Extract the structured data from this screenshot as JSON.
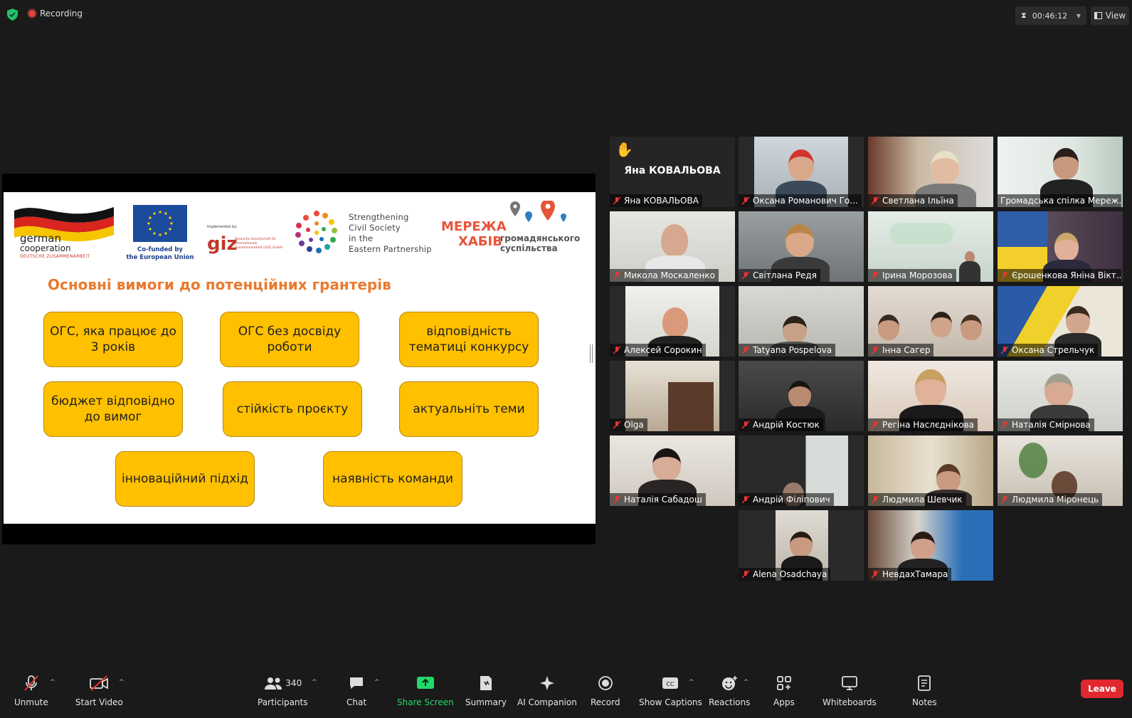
{
  "topbar": {
    "recording_label": "Recording",
    "timer": "00:46:12",
    "view_label": "View"
  },
  "slide": {
    "logos": {
      "german_line1": "german",
      "german_line2": "cooperation",
      "german_sub": "DEUTSCHE ZUSAMMENARBEIT",
      "eu_line1": "Co-funded by",
      "eu_line2": "the European Union",
      "giz_implemented": "Implemented by:",
      "giz": "giz",
      "giz_small": "Deutsche Gesellschaft für Internationale Zusammenarbeit (GIZ) GmbH",
      "strength_1": "Strengthening",
      "strength_2": "Civil Society",
      "strength_3": "in the",
      "strength_4": "Eastern Partnership",
      "mer_1": "МЕРЕЖА",
      "mer_2": "ХАБІВ",
      "mer_3": "громадянського",
      "mer_4": "суспільства"
    },
    "heading": "Основні вимоги до потенційних грантерів",
    "boxes": [
      "ОГС, яка працює до 3 років",
      "ОГС без досвіду роботи",
      "відповідність тематиці конкурсу",
      "бюджет відповідно до вимог",
      "стійкість проєкту",
      "актуальніть теми",
      "інноваційний підхід",
      "наявність команди"
    ]
  },
  "gallery": {
    "raised_hand_name": "Яна КОВАЛЬОВА",
    "participants": [
      "Яна КОВАЛЬОВА",
      "Оксана Романович Го...",
      "Светлана Ільїна",
      "Громадська спілка Мереж...",
      "Микола Москаленко",
      "Світлана Редя",
      "Ірина Морозова",
      "Єрошенкова Яніна Вікт...",
      "Алексей Сорокин",
      "Tatyana Pospelova",
      "Інна Сагер",
      "Оксана Стрельчук",
      "Olga",
      "Андрій Костюк",
      "Регіна Наслєднікова",
      "Наталія Смірнова",
      "Наталія Сабадош",
      "Андрій Філіпович",
      "Людмила Шевчик",
      "Людмила Міронець",
      "Alena Osadchaya",
      "НевдахТамара"
    ]
  },
  "toolbar": {
    "unmute": "Unmute",
    "start_video": "Start Video",
    "participants": "Participants",
    "participants_count": "340",
    "chat": "Chat",
    "share_screen": "Share Screen",
    "summary": "Summary",
    "ai_companion": "AI Companion",
    "record": "Record",
    "show_captions": "Show Captions",
    "reactions": "Reactions",
    "apps": "Apps",
    "whiteboards": "Whiteboards",
    "notes": "Notes",
    "leave": "Leave"
  },
  "colors": {
    "accent_green": "#23d96b",
    "leave_red": "#e0282e",
    "box_yellow": "#ffc000",
    "heading_orange": "#e87a2e",
    "active_speaker": "#c9e86a"
  }
}
